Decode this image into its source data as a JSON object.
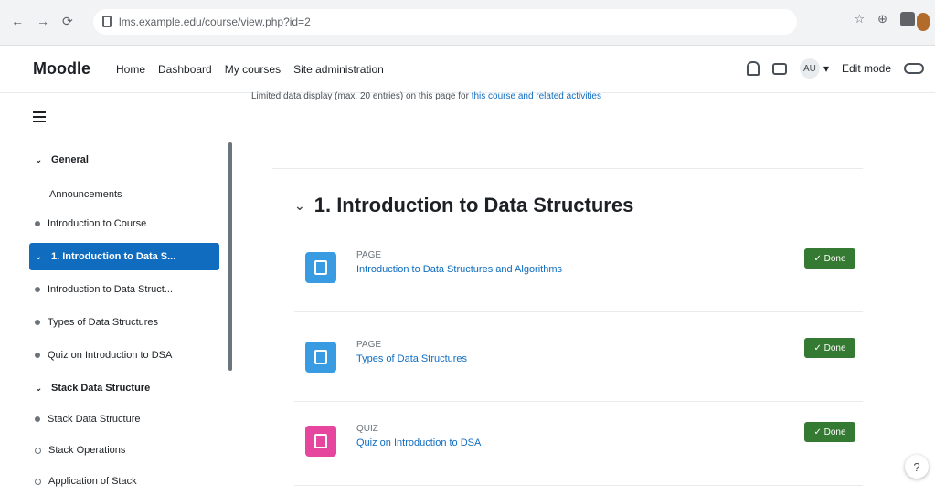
{
  "browser": {
    "nav": {
      "back": "←",
      "forward": "→",
      "reload": "⟳"
    },
    "url": "lms.example.edu/course/view.php?id=2",
    "tools": [
      "☆",
      "⊕"
    ]
  },
  "navbar": {
    "brand": "Moodle",
    "links": [
      "Home",
      "Dashboard",
      "My courses",
      "Site administration"
    ],
    "user_initials": "AU",
    "user_caret": "▾",
    "edit_mode_label": "Edit mode"
  },
  "notice": {
    "text": "Limited data display (max. 20 entries) on this page for",
    "link": "this course and related activities"
  },
  "drawer": {
    "items": [
      {
        "label": "General",
        "kind": "section",
        "chev": "⌄"
      },
      {
        "label": "Announcements",
        "kind": "sub"
      },
      {
        "label": "Introduction to Course",
        "kind": "dot"
      },
      {
        "label": "1. Introduction to Data S...",
        "kind": "active",
        "chev": "⌄"
      },
      {
        "label": "Introduction to Data Struct...",
        "kind": "dot"
      },
      {
        "label": "Types of Data Structures",
        "kind": "dot"
      },
      {
        "label": "Quiz on Introduction to DSA",
        "kind": "dot"
      },
      {
        "label": "Stack Data Structure",
        "kind": "section",
        "chev": "⌄"
      },
      {
        "label": "Stack Data Structure",
        "kind": "dot"
      },
      {
        "label": "Stack Operations",
        "kind": "circle"
      },
      {
        "label": "Application of Stack",
        "kind": "circle"
      }
    ]
  },
  "main": {
    "section_chev": "⌄",
    "section_title": "1. Introduction to Data Structures",
    "activities": [
      {
        "type": "PAGE",
        "name": "Introduction to Data Structures and Algorithms",
        "done": "✓ Done",
        "color": "#399be2"
      },
      {
        "type": "PAGE",
        "name": "Types of Data Structures",
        "done": "✓ Done",
        "color": "#399be2"
      },
      {
        "type": "QUIZ",
        "name": "Quiz on Introduction to DSA",
        "done": "✓ Done",
        "color": "#e6469d"
      }
    ]
  },
  "help": {
    "label": "?"
  },
  "colors": {
    "primary": "#0f6cbf",
    "success": "#357a32",
    "page_icon": "#399be2",
    "quiz_icon": "#e6469d"
  }
}
